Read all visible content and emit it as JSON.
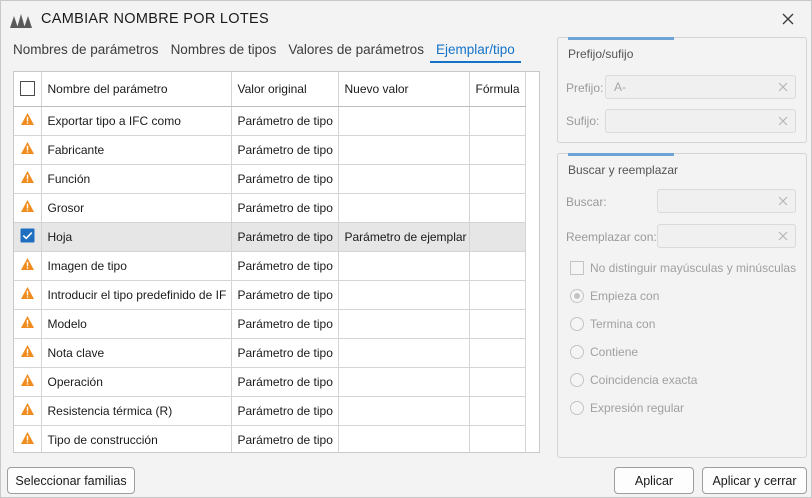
{
  "window": {
    "title": "CAMBIAR NOMBRE POR LOTES"
  },
  "tabs": [
    {
      "label": "Nombres de parámetros",
      "active": false
    },
    {
      "label": "Nombres de tipos",
      "active": false
    },
    {
      "label": "Valores de parámetros",
      "active": false
    },
    {
      "label": "Ejemplar/tipo",
      "active": true
    }
  ],
  "table": {
    "columns": [
      "Nombre del parámetro",
      "Valor original",
      "Nuevo valor",
      "Fórmula"
    ],
    "rows": [
      {
        "status": "warning-icon",
        "name": "Exportar tipo a IFC como",
        "original": "Parámetro de tipo",
        "new": "",
        "formula": ""
      },
      {
        "status": "warning-icon",
        "name": "Fabricante",
        "original": "Parámetro de tipo",
        "new": "",
        "formula": ""
      },
      {
        "status": "warning-icon",
        "name": "Función",
        "original": "Parámetro de tipo",
        "new": "",
        "formula": ""
      },
      {
        "status": "warning-icon",
        "name": "Grosor",
        "original": "Parámetro de tipo",
        "new": "",
        "formula": ""
      },
      {
        "status": "checked",
        "name": "Hoja",
        "original": "Parámetro de tipo",
        "new": "Parámetro de ejemplar",
        "formula": ""
      },
      {
        "status": "warning-icon",
        "name": "Imagen de tipo",
        "original": "Parámetro de tipo",
        "new": "",
        "formula": ""
      },
      {
        "status": "warning-icon",
        "name": "Introducir el tipo predefinido de IF",
        "original": "Parámetro de tipo",
        "new": "",
        "formula": ""
      },
      {
        "status": "warning-icon",
        "name": "Modelo",
        "original": "Parámetro de tipo",
        "new": "",
        "formula": ""
      },
      {
        "status": "warning-icon",
        "name": "Nota clave",
        "original": "Parámetro de tipo",
        "new": "",
        "formula": ""
      },
      {
        "status": "warning-icon",
        "name": "Operación",
        "original": "Parámetro de tipo",
        "new": "",
        "formula": ""
      },
      {
        "status": "warning-icon",
        "name": "Resistencia térmica (R)",
        "original": "Parámetro de tipo",
        "new": "",
        "formula": ""
      },
      {
        "status": "warning-icon",
        "name": "Tipo de construcción",
        "original": "Parámetro de tipo",
        "new": "",
        "formula": ""
      }
    ]
  },
  "prefix_suffix": {
    "title": "Prefijo/sufijo",
    "prefix_label": "Prefijo:",
    "prefix_value": "A-",
    "suffix_label": "Sufijo:",
    "suffix_value": ""
  },
  "find_replace": {
    "title": "Buscar y reemplazar",
    "find_label": "Buscar:",
    "find_value": "",
    "replace_label": "Reemplazar con:",
    "replace_value": "",
    "case_label": "No distinguir mayúsculas y minúsculas",
    "modes": [
      {
        "label": "Empieza con",
        "selected": true
      },
      {
        "label": "Termina con",
        "selected": false
      },
      {
        "label": "Contiene",
        "selected": false
      },
      {
        "label": "Coincidencia exacta",
        "selected": false
      },
      {
        "label": "Expresión regular",
        "selected": false
      }
    ]
  },
  "footer": {
    "select_families": "Seleccionar familias",
    "apply": "Aplicar",
    "apply_close": "Aplicar y cerrar"
  },
  "colors": {
    "accent": "#1473c8",
    "warning": "#f08c1e",
    "checkbox": "#1e6fbf"
  }
}
